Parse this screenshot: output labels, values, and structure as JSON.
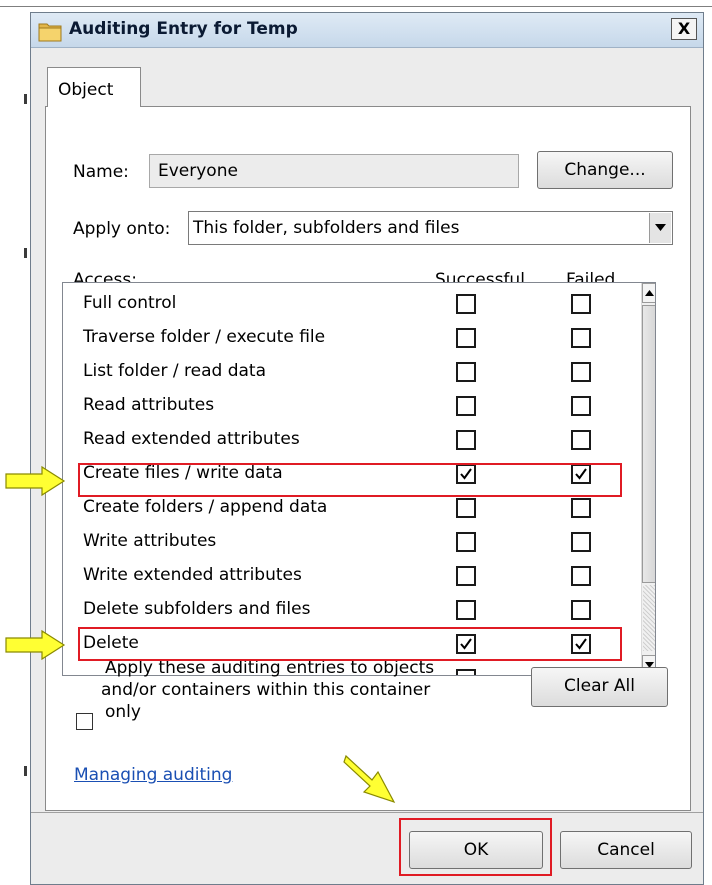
{
  "window": {
    "title": "Auditing Entry for Temp",
    "close_label": "X"
  },
  "tabs": [
    {
      "label": "Object"
    }
  ],
  "name": {
    "label": "Name:",
    "value": "Everyone",
    "change_button": "Change..."
  },
  "apply_onto": {
    "label": "Apply onto:",
    "value": "This folder, subfolders and files"
  },
  "access": {
    "header": "Access:",
    "successful_header": "Successful",
    "failed_header": "Failed",
    "rows": [
      {
        "label": "Full control",
        "successful": false,
        "failed": false
      },
      {
        "label": "Traverse folder / execute file",
        "successful": false,
        "failed": false
      },
      {
        "label": "List folder / read data",
        "successful": false,
        "failed": false
      },
      {
        "label": "Read attributes",
        "successful": false,
        "failed": false
      },
      {
        "label": "Read extended attributes",
        "successful": false,
        "failed": false
      },
      {
        "label": "Create files / write data",
        "successful": true,
        "failed": true
      },
      {
        "label": "Create folders / append data",
        "successful": false,
        "failed": false
      },
      {
        "label": "Write attributes",
        "successful": false,
        "failed": false
      },
      {
        "label": "Write extended attributes",
        "successful": false,
        "failed": false
      },
      {
        "label": "Delete subfolders and files",
        "successful": false,
        "failed": false
      },
      {
        "label": "Delete",
        "successful": true,
        "failed": true
      }
    ]
  },
  "apply_container": {
    "line1": "Apply these auditing entries to objects",
    "line2": "and/or containers within this container",
    "line3": "only",
    "checked": false
  },
  "clear_all_button": "Clear All",
  "managing_link": "Managing auditing",
  "footer": {
    "ok_button": "OK",
    "cancel_button": "Cancel"
  },
  "colors": {
    "highlight": "#e01b24",
    "arrow_fill": "#ffff33",
    "link": "#1a4fb3"
  }
}
